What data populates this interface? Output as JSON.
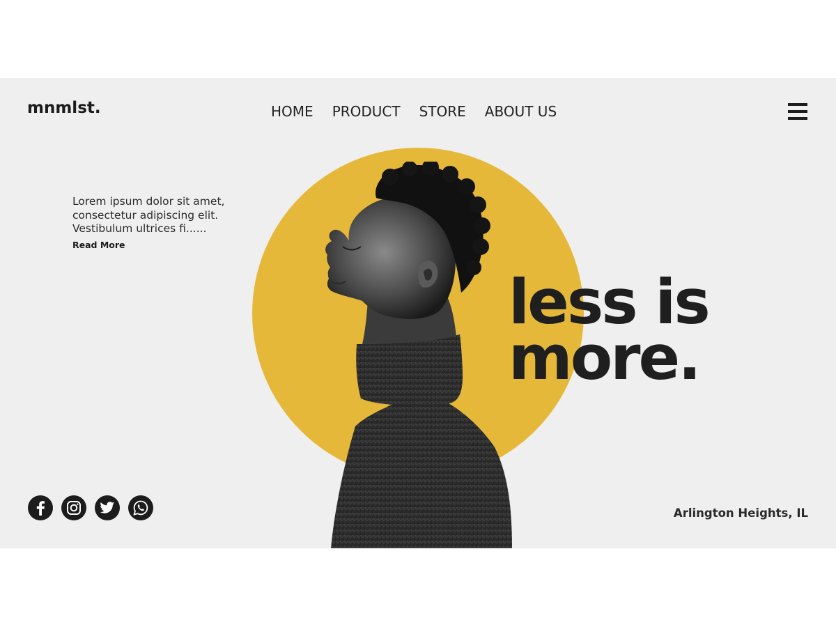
{
  "brand": {
    "logo": "mnmlst."
  },
  "nav": {
    "items": [
      {
        "label": "HOME"
      },
      {
        "label": "PRODUCT"
      },
      {
        "label": "STORE"
      },
      {
        "label": "ABOUT US"
      }
    ],
    "menu_icon": "hamburger-menu-icon"
  },
  "intro": {
    "lines": [
      "Lorem ipsum dolor sit amet,",
      "consectetur adipiscing elit.",
      "Vestibulum ultrices fi......"
    ],
    "read_more_label": "Read More"
  },
  "headline": {
    "line1": "less is",
    "line2": "more."
  },
  "socials": [
    {
      "icon": "facebook-icon"
    },
    {
      "icon": "instagram-icon"
    },
    {
      "icon": "twitter-icon"
    },
    {
      "icon": "whatsapp-icon"
    }
  ],
  "footer": {
    "location": "Arlington Heights, IL"
  },
  "colors": {
    "background": "#efefef",
    "accent": "#e6b83a",
    "text": "#1c1c1c"
  }
}
